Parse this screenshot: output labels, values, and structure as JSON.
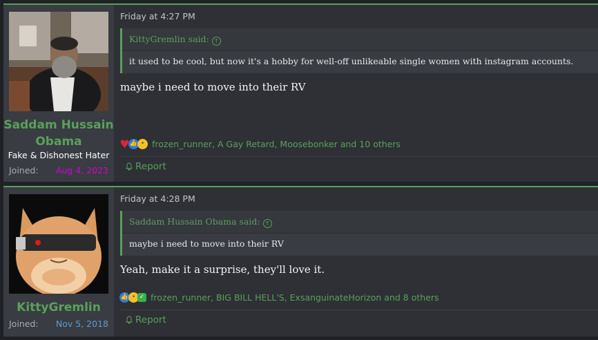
{
  "posts": [
    {
      "username": "Saddam Hussain Obama",
      "user_title": "Fake & Dishonest Hater",
      "joined_label": "Joined:",
      "joined_date": "Aug 4, 2023",
      "joined_date_color": "#d400d4",
      "date": "Friday at 4:27 PM",
      "quote_author": "KittyGremlin said:",
      "quote_text": "it used to be cool, but now it's a hobby for well-off unlikeable single women with instagram accounts.",
      "message": "maybe i need to move into their RV",
      "reaction_icons": [
        "heart-icon",
        "like-icon",
        "thinking-icon"
      ],
      "reaction_users": "frozen_runner, A Gay Retard, Moosebonker and 10 others",
      "report_label": "Report"
    },
    {
      "username": "KittyGremlin",
      "user_title": "",
      "joined_label": "Joined:",
      "joined_date": "Nov 5, 2018",
      "joined_date_color": "#5b9bd5",
      "date": "Friday at 4:28 PM",
      "quote_author": "Saddam Hussain Obama said:",
      "quote_text": "maybe i need to move into their RV",
      "message": "Yeah, make it a surprise, they'll love it.",
      "reaction_icons": [
        "like-icon",
        "thinking-icon",
        "check-icon"
      ],
      "reaction_users": "frozen_runner, BIG BILL HELL'S, ExsanguinateHorizon and 8 others",
      "report_label": "Report"
    }
  ],
  "colors": {
    "accent": "#5aa05a",
    "background": "#1f2126",
    "post_background": "#2e3035",
    "user_panel": "#393c42"
  }
}
